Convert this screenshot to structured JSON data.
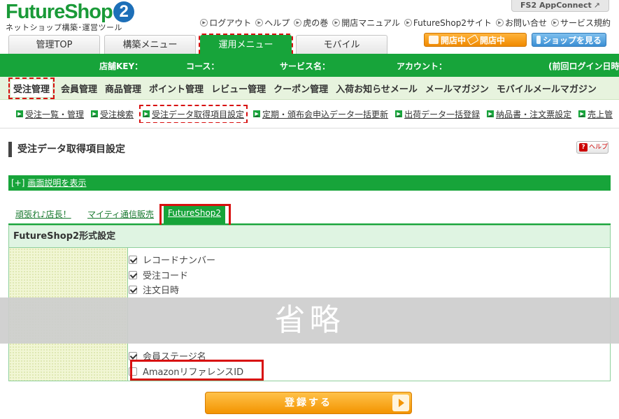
{
  "header": {
    "logo_main": "FutureShop",
    "logo_digit": "2",
    "logo_sub": "ネットショップ構築･運営ツール",
    "appconnect": "FS2 AppConnect",
    "toplinks": [
      "ログアウト",
      "ヘルプ",
      "虎の巻",
      "開店マニュアル",
      "FutureShop2サイト",
      "お問い合せ",
      "サービス規約"
    ]
  },
  "maintabs": [
    "管理TOP",
    "構築メニュー",
    "運用メニュー",
    "モバイル"
  ],
  "status_buttons": {
    "open1": "開店中",
    "open2": "開店中",
    "shop": "ショップを見る"
  },
  "infobar": {
    "store_key": "店舗KEY：",
    "course": "コース：",
    "service": "サービス名：",
    "account": "アカウント：",
    "last_login": "(前回ログイン日時"
  },
  "categories": [
    "受注管理",
    "会員管理",
    "商品管理",
    "ポイント管理",
    "レビュー管理",
    "クーポン管理",
    "入荷お知らせメール",
    "メールマガジン",
    "モバイルメールマガジン"
  ],
  "subnav": [
    "受注一覧・管理",
    "受注検索",
    "受注データ取得項目設定",
    "定期・頒布会申込データ一括更新",
    "出荷データ一括登録",
    "納品書・注文票設定",
    "売上管"
  ],
  "page_title": "受注データ取得項目設定",
  "help_label": "ヘルプ",
  "explain": {
    "prefix": "[+]",
    "link": "画面説明を表示"
  },
  "format_tabs": [
    "頑張れ♪店長！",
    "マイティ通信販売",
    "FutureShop2"
  ],
  "form": {
    "heading": "FutureShop2形式設定",
    "items_top": [
      {
        "label": "レコードナンバー",
        "checked": true
      },
      {
        "label": "受注コード",
        "checked": true
      },
      {
        "label": "注文日時",
        "checked": true
      }
    ],
    "items_bottom": [
      {
        "label": "会員ステージ名",
        "checked": true
      },
      {
        "label": "AmazonリファレンスID",
        "checked": false
      }
    ]
  },
  "omitted_label": "省略",
  "register_label": "登録する",
  "colors": {
    "brand_green": "#17a43a",
    "highlight_red": "#d81010",
    "button_orange": "#f39400"
  }
}
